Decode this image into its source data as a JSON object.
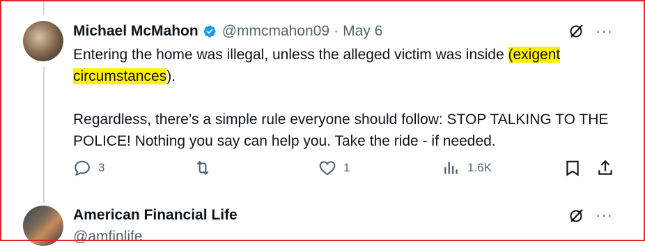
{
  "tweet1": {
    "name": "Michael McMahon",
    "handle": "@mmcmahon09",
    "separator": "·",
    "date": "May 6",
    "text": {
      "part1": "Entering the home was illegal, unless the alleged victim was inside ",
      "highlight": "(exigent circumstances",
      "part2": ").",
      "para2": "Regardless, there’s a simple rule everyone should follow: STOP TALKING TO THE POLICE!  Nothing you say can help you. Take the ride - if needed."
    },
    "actions": {
      "replies": "3",
      "reposts": "",
      "likes": "1",
      "views": "1.6K"
    },
    "more": "···"
  },
  "tweet2": {
    "name": "American Financial Life",
    "handle": "@amfinlife",
    "more": "···"
  },
  "colors": {
    "verified": "#1d9bf0",
    "highlight": "#fff100",
    "secondary_text": "#536471",
    "frame": "#e0242b"
  },
  "icons": [
    "verified-badge-icon",
    "grok-icon",
    "more-icon",
    "reply-icon",
    "repost-icon",
    "like-icon",
    "views-icon",
    "bookmark-icon",
    "share-icon"
  ]
}
